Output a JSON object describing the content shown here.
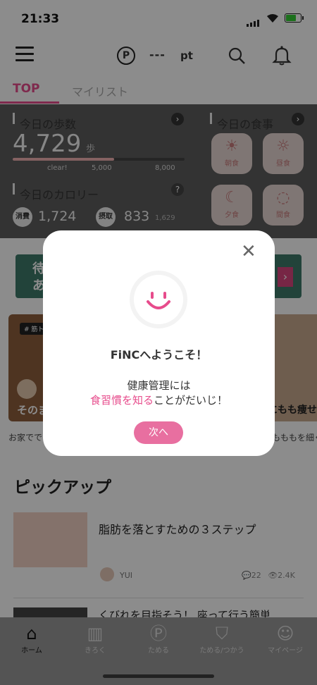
{
  "status": {
    "time": "21:33"
  },
  "header": {
    "points_symbol": "P",
    "points": "---",
    "unit": "pt"
  },
  "tabs": {
    "top": "TOP",
    "mylist": "マイリスト"
  },
  "steps": {
    "label": "今日の歩数",
    "value": "4,729",
    "unit": "歩",
    "clear_label": "clear!",
    "tick1": "5,000",
    "tick2": "8,000",
    "progress_fraction": 0.59
  },
  "calories": {
    "label": "今日のカロリー",
    "consumed_label": "消費",
    "consumed": "1,724",
    "intake_label": "摂取",
    "intake": "833",
    "intake_target": "1,629"
  },
  "meals": {
    "label": "今日の食事",
    "breakfast": "朝食",
    "lunch": "昼食",
    "dinner": "夕食",
    "snack": "間食"
  },
  "banner": {
    "text1": "待",
    "text2": "あ"
  },
  "cards": {
    "tag": "# 筋ト",
    "left_text": "そのま",
    "right_text": "にもも痩せ",
    "caption_left": "お家でで",
    "caption_right": "もももを細く"
  },
  "pickup": {
    "title": "ピックアップ"
  },
  "article": {
    "title": "脂肪を落とすための３ステップ",
    "author": "YUI",
    "comments": "22",
    "views": "2.4K"
  },
  "article2": {
    "title": "くびれを目指そう！ 座って行う簡単"
  },
  "modal": {
    "welcome": "FiNCへようこそ！",
    "line1": "健康管理には",
    "highlight": "食習慣を知る",
    "line2_rest": "ことがだいじ！",
    "button": "次へ"
  },
  "tabbar": {
    "home": "ホーム",
    "record": "きろく",
    "save": "ためる",
    "save_use": "ためる/つかう",
    "mypage": "マイページ"
  },
  "colors": {
    "accent": "#e74c8c",
    "button": "#e86fa0",
    "panel": "#5e5e5e"
  }
}
